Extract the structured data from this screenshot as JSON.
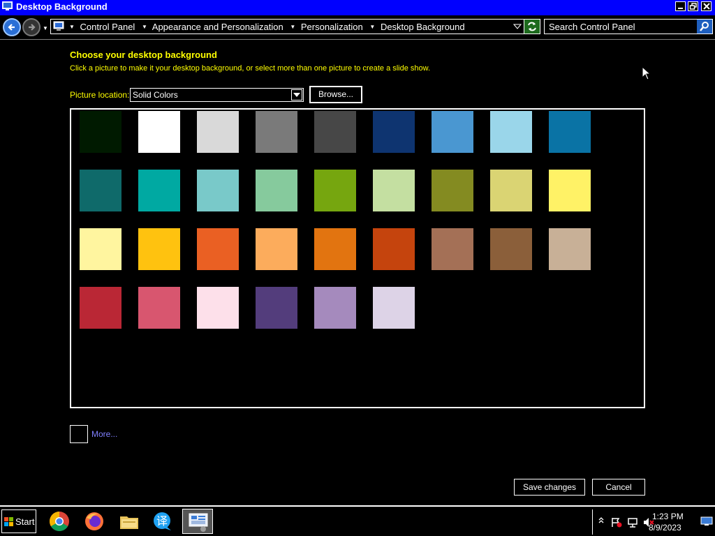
{
  "window": {
    "title": "Desktop Background"
  },
  "address": {
    "breadcrumbs": [
      "Control Panel",
      "Appearance and Personalization",
      "Personalization",
      "Desktop Background"
    ]
  },
  "search": {
    "placeholder": "Search Control Panel"
  },
  "content": {
    "heading": "Choose your desktop background",
    "subtext": "Click a picture to make it your desktop background, or select more than one picture to create a slide show.",
    "location_label": "Picture location:",
    "location_value": "Solid Colors",
    "browse_label": "Browse...",
    "more_label": "More...",
    "save_label": "Save changes",
    "cancel_label": "Cancel"
  },
  "swatches": [
    [
      "#001a00",
      "#ffffff",
      "#d9d9d9",
      "#7a7a7a",
      "#474747",
      "#0e3470",
      "#4a97d1",
      "#9ad6ea",
      "#0a73a5"
    ],
    [
      "#0f6a6a",
      "#00a9a2",
      "#79c9c9",
      "#86ca9d",
      "#76a60f",
      "#c4dfa1",
      "#848b21",
      "#dad473",
      "#fff266"
    ],
    [
      "#fff59f",
      "#ffc20f",
      "#ea6023",
      "#fcac5c",
      "#e27410",
      "#c5440d",
      "#a47056",
      "#8b5f3a",
      "#c8b097"
    ],
    [
      "#ba2735",
      "#d8566f",
      "#fde0ea",
      "#533d7c",
      "#a58abd",
      "#ddd3e7"
    ]
  ],
  "taskbar": {
    "start_label": "Start",
    "apps": [
      "chrome-icon",
      "firefox-icon",
      "file-explorer-icon",
      "translator-icon",
      "control-panel-icon"
    ],
    "time": "1:23 PM",
    "date": "8/9/2023"
  },
  "colors": {
    "titlebar": "#0000ff",
    "heading": "#ffff00",
    "link": "#8080ff"
  }
}
